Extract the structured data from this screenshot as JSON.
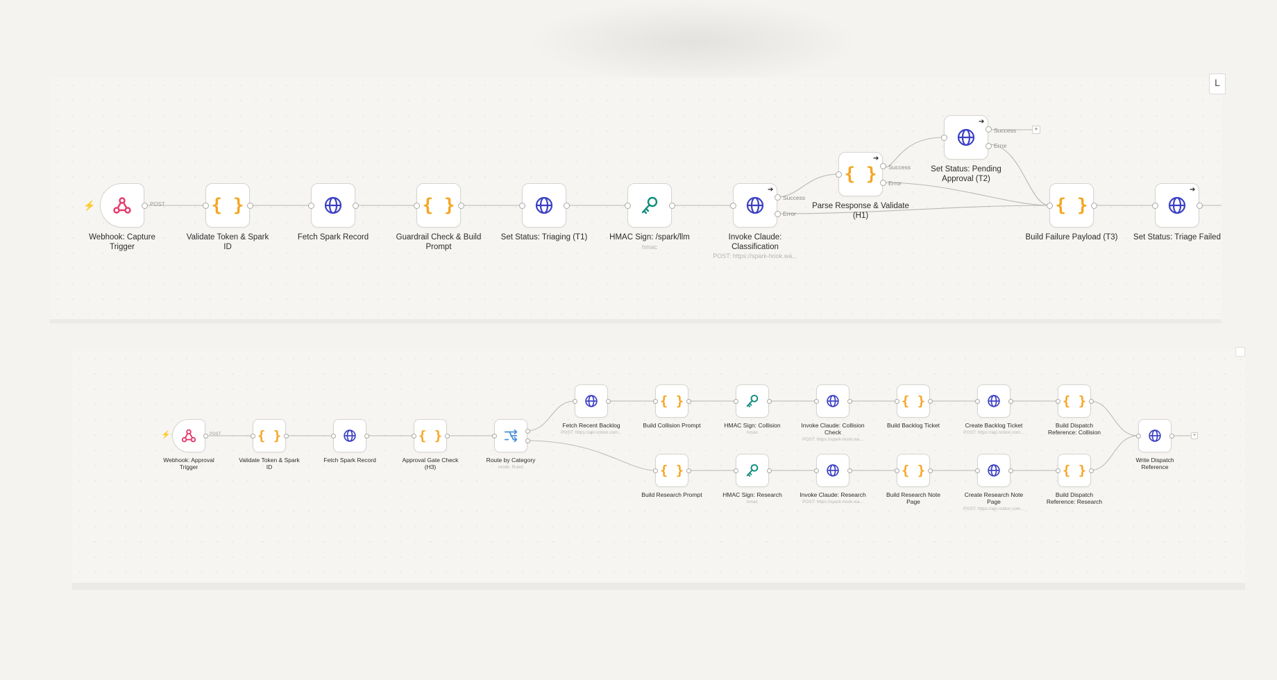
{
  "colors": {
    "trigger": "#e63a6a",
    "code": "#f5a623",
    "http": "#3b3fc4",
    "crypto": "#0f8c7b",
    "switch": "#4a90d9",
    "bolt": "#f47c20"
  },
  "workflow1": {
    "nodes": [
      {
        "label": "Webhook: Capture Trigger",
        "icon": "webhook-icon",
        "sub": ""
      },
      {
        "label": "Validate Token & Spark ID",
        "icon": "code-braces-icon",
        "sub": ""
      },
      {
        "label": "Fetch Spark Record",
        "icon": "globe-icon",
        "sub": ""
      },
      {
        "label": "Guardrail Check & Build Prompt",
        "icon": "code-braces-icon",
        "sub": ""
      },
      {
        "label": "Set Status: Triaging (T1)",
        "icon": "globe-icon",
        "sub": ""
      },
      {
        "label": "HMAC Sign: /spark/llm",
        "icon": "key-icon",
        "sub": "hmac"
      },
      {
        "label": "Invoke Claude: Classification",
        "icon": "globe-icon",
        "sub": "POST: https://spark-hook.wa..."
      },
      {
        "label": "Parse Response & Validate (H1)",
        "icon": "code-braces-icon",
        "sub": ""
      },
      {
        "label": "Set Status: Pending Approval (T2)",
        "icon": "globe-icon",
        "sub": ""
      },
      {
        "label": "Build Failure Payload (T3)",
        "icon": "code-braces-icon",
        "sub": ""
      },
      {
        "label": "Set Status: Triage Failed",
        "icon": "globe-icon",
        "sub": ""
      }
    ],
    "ports": {
      "webhook_out": "POST",
      "success": "Success",
      "error": "Error"
    }
  },
  "workflow2": {
    "nodes": [
      {
        "label": "Webhook: Approval Trigger",
        "icon": "webhook-icon",
        "sub": ""
      },
      {
        "label": "Validate Token & Spark ID",
        "icon": "code-braces-icon",
        "sub": ""
      },
      {
        "label": "Fetch Spark Record",
        "icon": "globe-icon",
        "sub": ""
      },
      {
        "label": "Approval Gate Check (H3)",
        "icon": "code-braces-icon",
        "sub": ""
      },
      {
        "label": "Route by Category",
        "icon": "switch-icon",
        "sub": "mode: Rules"
      },
      {
        "label": "Fetch Recent Backlog",
        "icon": "globe-icon",
        "sub": "POST: https://api.notion.com..."
      },
      {
        "label": "Build Collision Prompt",
        "icon": "code-braces-icon",
        "sub": ""
      },
      {
        "label": "HMAC Sign: Collision",
        "icon": "key-icon",
        "sub": "hmac"
      },
      {
        "label": "Invoke Claude: Collision Check",
        "icon": "globe-icon",
        "sub": "POST: https://spark-hook.wa..."
      },
      {
        "label": "Build Backlog Ticket",
        "icon": "code-braces-icon",
        "sub": ""
      },
      {
        "label": "Create Backlog Ticket",
        "icon": "globe-icon",
        "sub": "POST: https://api.notion.com..."
      },
      {
        "label": "Build Dispatch Reference: Collision",
        "icon": "code-braces-icon",
        "sub": ""
      },
      {
        "label": "Build Research Prompt",
        "icon": "code-braces-icon",
        "sub": ""
      },
      {
        "label": "HMAC Sign: Research",
        "icon": "key-icon",
        "sub": "hmac"
      },
      {
        "label": "Invoke Claude: Research",
        "icon": "globe-icon",
        "sub": "POST: https://spark-hook.wa..."
      },
      {
        "label": "Build Research Note Page",
        "icon": "code-braces-icon",
        "sub": ""
      },
      {
        "label": "Create Research Note Page",
        "icon": "globe-icon",
        "sub": "POST: https://api.notion.com..."
      },
      {
        "label": "Build Dispatch Reference: Research",
        "icon": "code-braces-icon",
        "sub": ""
      },
      {
        "label": "Write Dispatch Reference",
        "icon": "globe-icon",
        "sub": ""
      }
    ],
    "ports": {
      "webhook_out": "POST"
    }
  },
  "ui": {
    "clip_tab": "L",
    "plus": "+",
    "arrow": "➔",
    "bolt": "⚡"
  }
}
